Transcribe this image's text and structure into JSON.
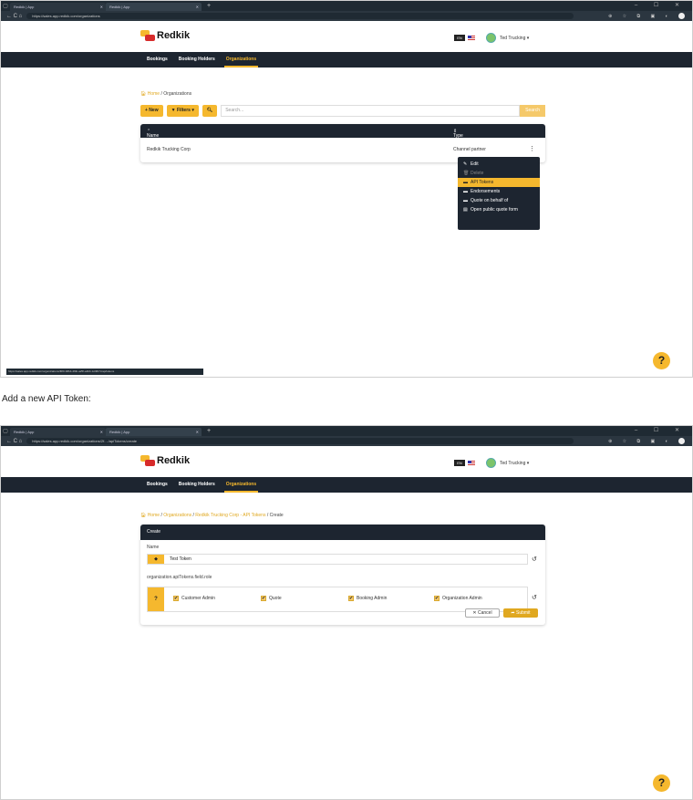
{
  "browser": {
    "tab1_title": "Redkik | App",
    "tab2_title": "Redkik | App",
    "new_tab": "+",
    "window_controls": "– ☐ ✕",
    "nav_icons": "← C ⌂",
    "url1": "https://sales.app.redkik.com/organizations",
    "url2": "https://sales.app.redkik.com/organizations/2f..../apiTokens/create",
    "ext_icons": "⊕ ☆ ⧉ ▣ ◐"
  },
  "app": {
    "logo_text": "Redkik",
    "user_name": "Ted Trucking",
    "flag_label": "EN"
  },
  "nav": {
    "bookings": "Bookings",
    "booking_holders": "Booking Holders",
    "organizations": "Organizations"
  },
  "screen1": {
    "breadcrumb_home": "Home",
    "breadcrumb_sep": "/",
    "breadcrumb_current": "Organizations",
    "new_button": "+ New",
    "filters_button": "Filters",
    "search_placeholder": "Search...",
    "search_button": "Search",
    "col_name": "Name",
    "col_type": "Type",
    "row_name": "Redkik Trucking Corp",
    "row_type": "Channel partner",
    "menu_kebab": "⋮",
    "status_url": "https://sales.app.redkik.com/organizations/f0f0-b8b4-4f4b-a25f-a4bb-txt/#b7crap/tokens"
  },
  "menu": {
    "edit": "Edit",
    "delete": "Delete",
    "api_tokens": "API Tokens",
    "endorsements": "Endorsements",
    "quote_on_behalf": "Quote on behalf of",
    "open_public_quote": "Open public quote form"
  },
  "caption": "Add a new API Token:",
  "screen2": {
    "breadcrumb_home": "Home",
    "breadcrumb_organizations": "Organizations",
    "breadcrumb_org": "Redkik Trucking Corp - API Tokens",
    "breadcrumb_create": "Create",
    "form_title": "Create",
    "name_label": "Name",
    "name_value": "Test Token",
    "role_label": "organization.apiTokens.field.role",
    "role_question": "?",
    "roles": [
      "Customer Admin",
      "Quote",
      "Booking Admin",
      "Organization Admin"
    ],
    "cancel_button": "✕ Cancel",
    "submit_button": "➦ Submit"
  },
  "help_label": "?"
}
